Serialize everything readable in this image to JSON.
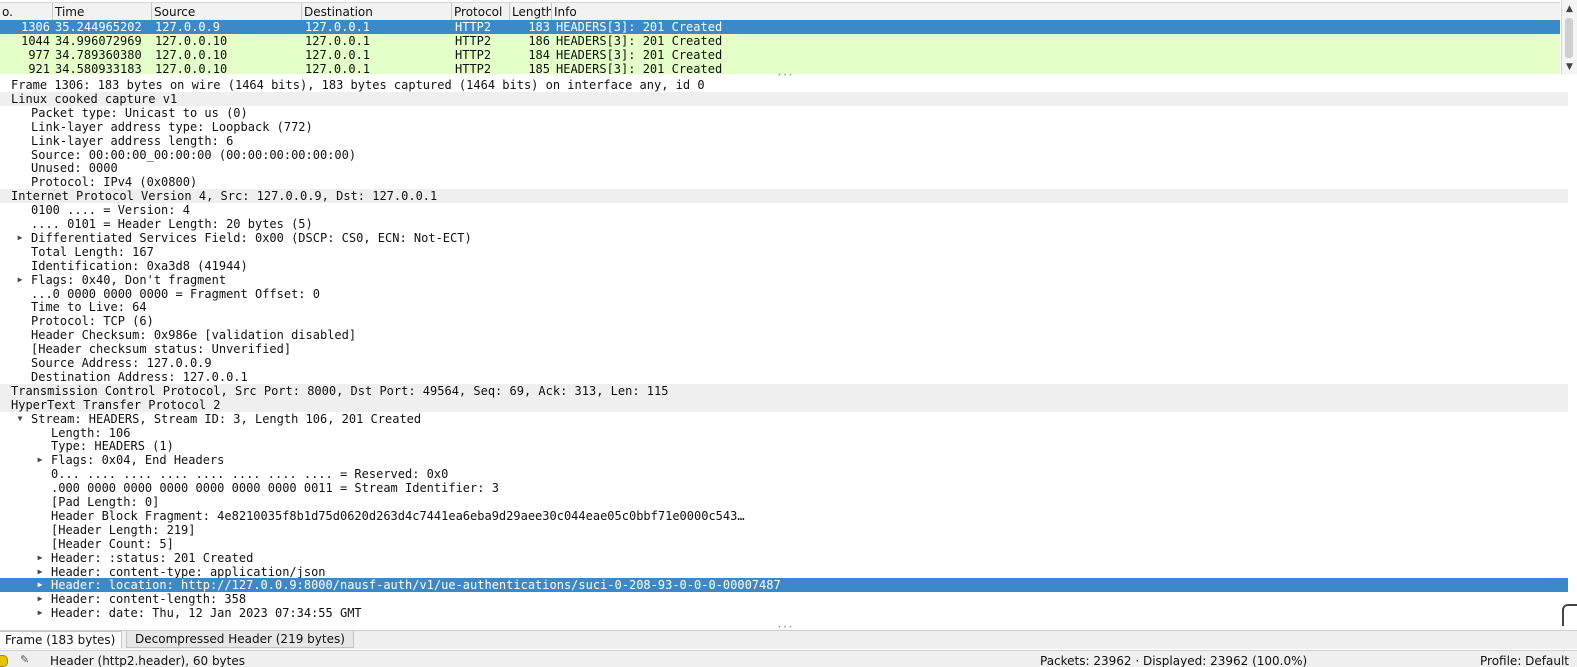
{
  "packet_list": {
    "columns": [
      "o.",
      "Time",
      "Source",
      "Destination",
      "Protocol",
      "Length",
      "Info"
    ],
    "rows": [
      {
        "no": "1306",
        "time": "35.244965202",
        "src": "127.0.0.9",
        "dst": "127.0.0.1",
        "proto": "HTTP2",
        "len": "183",
        "info": "HEADERS[3]: 201 Created",
        "selected": true
      },
      {
        "no": "1044",
        "time": "34.996072969",
        "src": "127.0.0.10",
        "dst": "127.0.0.1",
        "proto": "HTTP2",
        "len": "186",
        "info": "HEADERS[3]: 201 Created",
        "selected": false
      },
      {
        "no": "977",
        "time": "34.789360380",
        "src": "127.0.0.10",
        "dst": "127.0.0.1",
        "proto": "HTTP2",
        "len": "184",
        "info": "HEADERS[3]: 201 Created",
        "selected": false
      },
      {
        "no": "921",
        "time": "34.580933183",
        "src": "127.0.0.10",
        "dst": "127.0.0.1",
        "proto": "HTTP2",
        "len": "185",
        "info": "HEADERS[3]: 201 Created",
        "selected": false
      }
    ]
  },
  "details": [
    {
      "text": "Frame 1306: 183 bytes on wire (1464 bits), 183 bytes captured (1464 bits) on interface any, id 0",
      "level": 0,
      "arrow": "none",
      "style": "white"
    },
    {
      "text": "Linux cooked capture v1",
      "level": 0,
      "arrow": "none",
      "style": "gray"
    },
    {
      "text": "Packet type: Unicast to us (0)",
      "level": 1,
      "arrow": "none",
      "style": "white"
    },
    {
      "text": "Link-layer address type: Loopback (772)",
      "level": 1,
      "arrow": "none",
      "style": "white"
    },
    {
      "text": "Link-layer address length: 6",
      "level": 1,
      "arrow": "none",
      "style": "white"
    },
    {
      "text": "Source: 00:00:00_00:00:00 (00:00:00:00:00:00)",
      "level": 1,
      "arrow": "none",
      "style": "white"
    },
    {
      "text": "Unused: 0000",
      "level": 1,
      "arrow": "none",
      "style": "white"
    },
    {
      "text": "Protocol: IPv4 (0x0800)",
      "level": 1,
      "arrow": "none",
      "style": "white"
    },
    {
      "text": "Internet Protocol Version 4, Src: 127.0.0.9, Dst: 127.0.0.1",
      "level": 0,
      "arrow": "none",
      "style": "gray"
    },
    {
      "text": "0100 .... = Version: 4",
      "level": 1,
      "arrow": "none",
      "style": "white"
    },
    {
      "text": ".... 0101 = Header Length: 20 bytes (5)",
      "level": 1,
      "arrow": "none",
      "style": "white"
    },
    {
      "text": "Differentiated Services Field: 0x00 (DSCP: CS0, ECN: Not-ECT)",
      "level": 1,
      "arrow": "right",
      "style": "white"
    },
    {
      "text": "Total Length: 167",
      "level": 1,
      "arrow": "none",
      "style": "white"
    },
    {
      "text": "Identification: 0xa3d8 (41944)",
      "level": 1,
      "arrow": "none",
      "style": "white"
    },
    {
      "text": "Flags: 0x40, Don't fragment",
      "level": 1,
      "arrow": "right",
      "style": "white"
    },
    {
      "text": "...0 0000 0000 0000 = Fragment Offset: 0",
      "level": 1,
      "arrow": "none",
      "style": "white"
    },
    {
      "text": "Time to Live: 64",
      "level": 1,
      "arrow": "none",
      "style": "white"
    },
    {
      "text": "Protocol: TCP (6)",
      "level": 1,
      "arrow": "none",
      "style": "white"
    },
    {
      "text": "Header Checksum: 0x986e [validation disabled]",
      "level": 1,
      "arrow": "none",
      "style": "white"
    },
    {
      "text": "[Header checksum status: Unverified]",
      "level": 1,
      "arrow": "none",
      "style": "white"
    },
    {
      "text": "Source Address: 127.0.0.9",
      "level": 1,
      "arrow": "none",
      "style": "white"
    },
    {
      "text": "Destination Address: 127.0.0.1",
      "level": 1,
      "arrow": "none",
      "style": "white"
    },
    {
      "text": "Transmission Control Protocol, Src Port: 8000, Dst Port: 49564, Seq: 69, Ack: 313, Len: 115",
      "level": 0,
      "arrow": "none",
      "style": "gray"
    },
    {
      "text": "HyperText Transfer Protocol 2",
      "level": 0,
      "arrow": "none",
      "style": "gray"
    },
    {
      "text": "Stream: HEADERS, Stream ID: 3, Length 106, 201 Created",
      "level": 1,
      "arrow": "down",
      "style": "white"
    },
    {
      "text": "Length: 106",
      "level": 2,
      "arrow": "none",
      "style": "white"
    },
    {
      "text": "Type: HEADERS (1)",
      "level": 2,
      "arrow": "none",
      "style": "white"
    },
    {
      "text": "Flags: 0x04, End Headers",
      "level": 2,
      "arrow": "right",
      "style": "white"
    },
    {
      "text": "0... .... .... .... .... .... .... .... = Reserved: 0x0",
      "level": 2,
      "arrow": "none",
      "style": "white"
    },
    {
      "text": ".000 0000 0000 0000 0000 0000 0000 0011 = Stream Identifier: 3",
      "level": 2,
      "arrow": "none",
      "style": "white"
    },
    {
      "text": "[Pad Length: 0]",
      "level": 2,
      "arrow": "none",
      "style": "white"
    },
    {
      "text": "Header Block Fragment: 4e8210035f8b1d75d0620d263d4c7441ea6eba9d29aee30c044eae05c0bbf71e0000c543…",
      "level": 2,
      "arrow": "none",
      "style": "white"
    },
    {
      "text": "[Header Length: 219]",
      "level": 2,
      "arrow": "none",
      "style": "white"
    },
    {
      "text": "[Header Count: 5]",
      "level": 2,
      "arrow": "none",
      "style": "white"
    },
    {
      "text": "Header: :status: 201 Created",
      "level": 2,
      "arrow": "right",
      "style": "white"
    },
    {
      "text": "Header: content-type: application/json",
      "level": 2,
      "arrow": "right",
      "style": "white"
    },
    {
      "text": "Header: location: http://127.0.0.9:8000/nausf-auth/v1/ue-authentications/suci-0-208-93-0-0-0-00007487",
      "level": 2,
      "arrow": "right",
      "style": "selected"
    },
    {
      "text": "Header: content-length: 358",
      "level": 2,
      "arrow": "right",
      "style": "white"
    },
    {
      "text": "Header: date: Thu, 12 Jan 2023 07:34:55 GMT",
      "level": 2,
      "arrow": "right",
      "style": "white"
    }
  ],
  "byte_tabs": {
    "frame": "Frame (183 bytes)",
    "decompressed": "Decompressed Header (219 bytes)"
  },
  "status_bar": {
    "field_info": "Header (http2.header), 60 bytes",
    "packets": "Packets: 23962 · Displayed: 23962 (100.0%)",
    "profile": "Profile: Default"
  },
  "colors": {
    "selection": "#3c89c9",
    "http2_row": "#e4ffc7",
    "section_row": "#efefef"
  }
}
